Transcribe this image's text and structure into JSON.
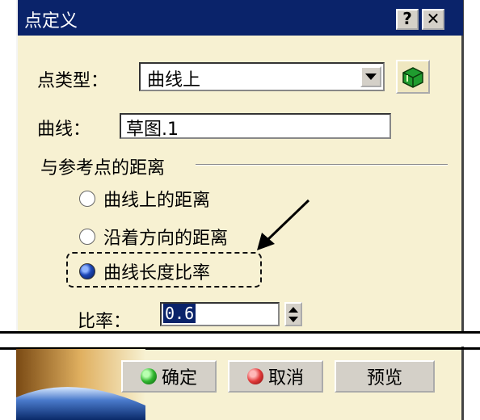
{
  "dialog": {
    "title": "点定义",
    "help_label": "?",
    "close_label": "✕"
  },
  "point_type": {
    "label": "点类型：",
    "value": "曲线上"
  },
  "curve": {
    "label": "曲线：",
    "value": "草图.1"
  },
  "distance_group": {
    "title": "与参考点的距离",
    "options": [
      {
        "label": "曲线上的距离",
        "selected": false
      },
      {
        "label": "沿着方向的距离",
        "selected": false
      },
      {
        "label": "曲线长度比率",
        "selected": true
      }
    ]
  },
  "ratio": {
    "label": "比率：",
    "value": "0.6"
  },
  "buttons": {
    "ok": "确定",
    "cancel": "取消",
    "preview": "预览"
  },
  "colors": {
    "title_bar": "#0a236a",
    "dialog_bg": "#f7f1d2",
    "ok_icon": "#2fb52f",
    "cancel_icon": "#e23a3a"
  }
}
